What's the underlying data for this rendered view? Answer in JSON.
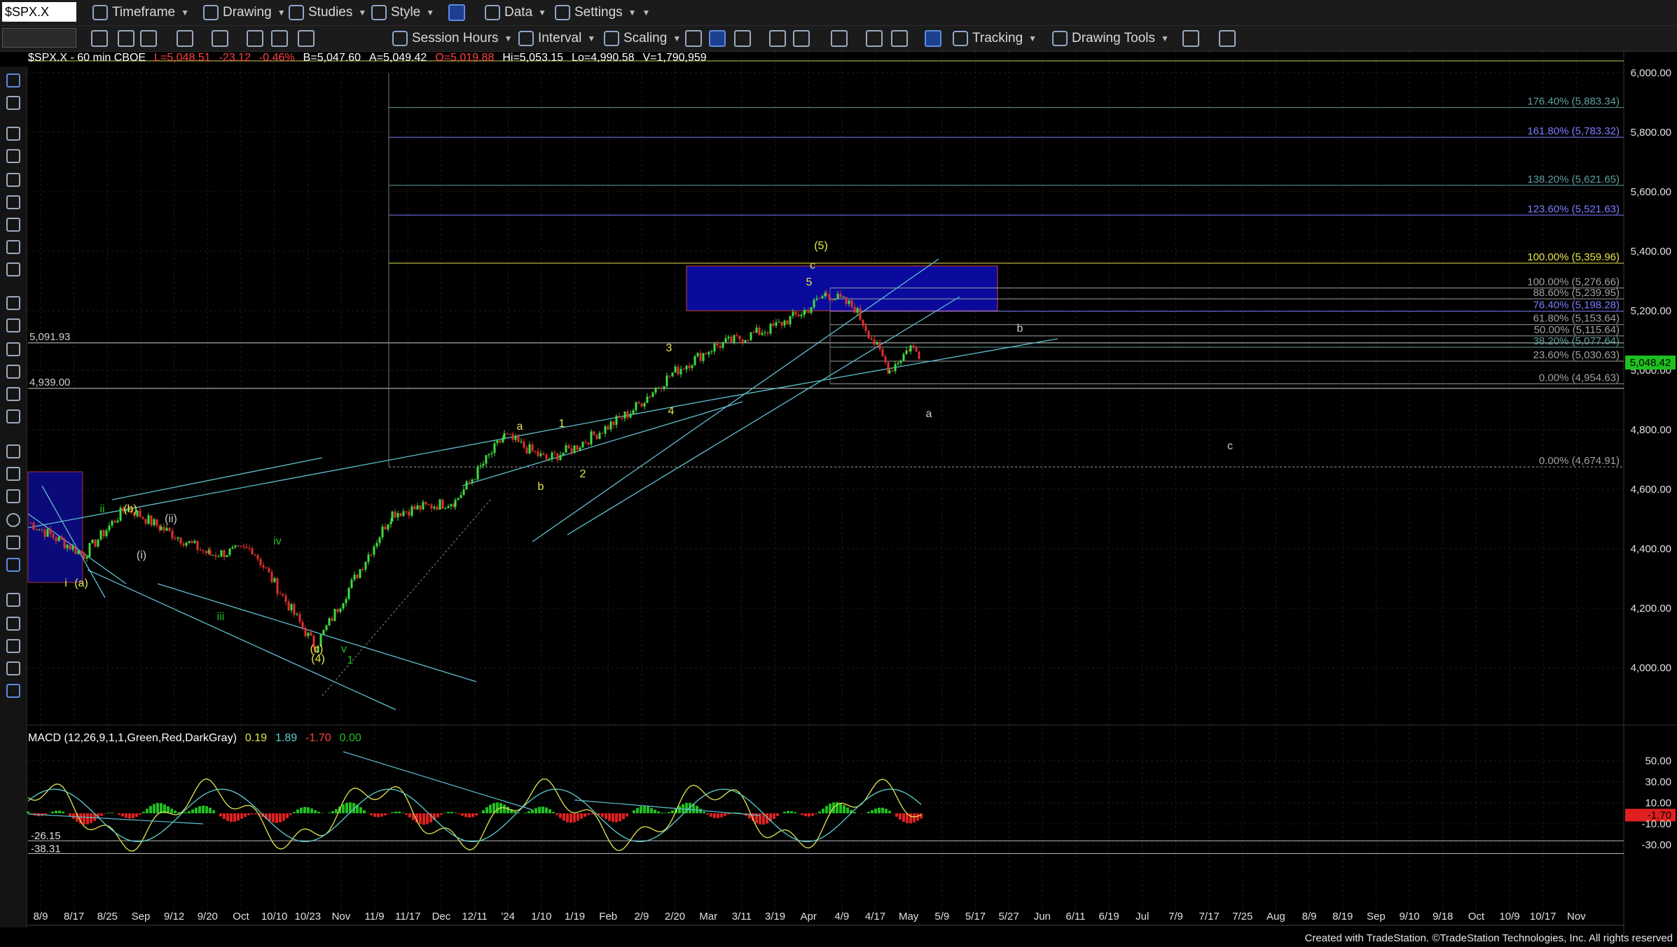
{
  "toolbar": {
    "symbol": "$SPX.X",
    "timeframe": "Timeframe",
    "drawing": "Drawing",
    "studies": "Studies",
    "style": "Style",
    "data": "Data",
    "settings": "Settings",
    "session_hours": "Session Hours",
    "interval": "Interval",
    "scaling": "Scaling",
    "tracking": "Tracking",
    "drawing_tools": "Drawing Tools"
  },
  "status": {
    "title": "$SPX.X - 60 min  CBOE",
    "last": "L=5,048.51",
    "change": "-23.12",
    "pct": "-0.46%",
    "bid": "B=5,047.60",
    "ask": "A=5,049.42",
    "open": "O=5,019.88",
    "high": "Hi=5,053.15",
    "low": "Lo=4,990.58",
    "volume": "V=1,790,959"
  },
  "price_axis": [
    "6,000.00",
    "5,800.00",
    "5,600.00",
    "5,400.00",
    "5,200.00",
    "5,000.00",
    "4,800.00",
    "4,600.00",
    "4,400.00",
    "4,200.00",
    "4,000.00"
  ],
  "last_price_tag": "5,048.42",
  "macd_axis": [
    "50.00",
    "30.00",
    "10.00",
    "-1.70",
    "-10.00",
    "-30.00"
  ],
  "date_axis": [
    "8/9",
    "8/17",
    "8/25",
    "Sep",
    "9/12",
    "9/20",
    "Oct",
    "10/10",
    "10/23",
    "Nov",
    "11/9",
    "11/17",
    "Dec",
    "12/11",
    "'24",
    "1/10",
    "1/19",
    "Feb",
    "2/9",
    "2/20",
    "Mar",
    "3/11",
    "3/19",
    "Apr",
    "4/9",
    "4/17",
    "May",
    "5/9",
    "5/17",
    "5/27",
    "Jun",
    "6/11",
    "6/19",
    "Jul",
    "7/9",
    "7/17",
    "7/25",
    "Aug",
    "8/9",
    "8/19",
    "Sep",
    "9/10",
    "9/18",
    "Oct",
    "10/9",
    "10/17",
    "Nov"
  ],
  "fib_levels": [
    {
      "label": "176.40% (5,883.34)",
      "color": "#5f9ea0"
    },
    {
      "label": "161.80% (5,783.32)",
      "color": "#7b7bff"
    },
    {
      "label": "138.20% (5,621.65)",
      "color": "#5f9ea0"
    },
    {
      "label": "123.60% (5,521.63)",
      "color": "#7b7bff"
    },
    {
      "label": "100.00% (5,359.96)",
      "color": "#e6e650"
    },
    {
      "label": "100.00% (5,276.66)",
      "color": "#a0a0a0"
    },
    {
      "label": "88.60% (5,239.95)",
      "color": "#a0a0a0"
    },
    {
      "label": "76.40% (5,198.28)",
      "color": "#7b7bff"
    },
    {
      "label": "61.80% (5,153.64)",
      "color": "#a0a0a0"
    },
    {
      "label": "50.00% (5,115.64)",
      "color": "#a0a0a0"
    },
    {
      "label": "38.20% (5,077.64)",
      "color": "#5f9ea0"
    },
    {
      "label": "23.60% (5,030.63)",
      "color": "#a0a0a0"
    },
    {
      "label": "0.00% (4,954.63)",
      "color": "#a0a0a0"
    },
    {
      "label": "0.00% (4,674.91)",
      "color": "#a0a0a0"
    }
  ],
  "hlines": [
    {
      "label": "5,091.93"
    },
    {
      "label": "4,939.00"
    }
  ],
  "macd": {
    "label": "MACD (12,26,9,1,1,Green,Red,DarkGray)",
    "v1": "0.19",
    "v2": "1.89",
    "v3": "-1.70",
    "v4": "0.00",
    "levels": [
      "-26.15",
      "-38.31"
    ]
  },
  "wave_labels": [
    "(5)",
    "c",
    "5",
    "3",
    "4",
    "1",
    "2",
    "a",
    "b",
    "(a)",
    "(b)",
    "i",
    "ii",
    "iii",
    "iv",
    "v",
    "(i)",
    "(ii)",
    "(c)",
    "(4)",
    "1",
    "b",
    "a",
    "c"
  ],
  "footer": "Created with TradeStation. ©TradeStation Technologies, Inc. All rights reserved"
}
